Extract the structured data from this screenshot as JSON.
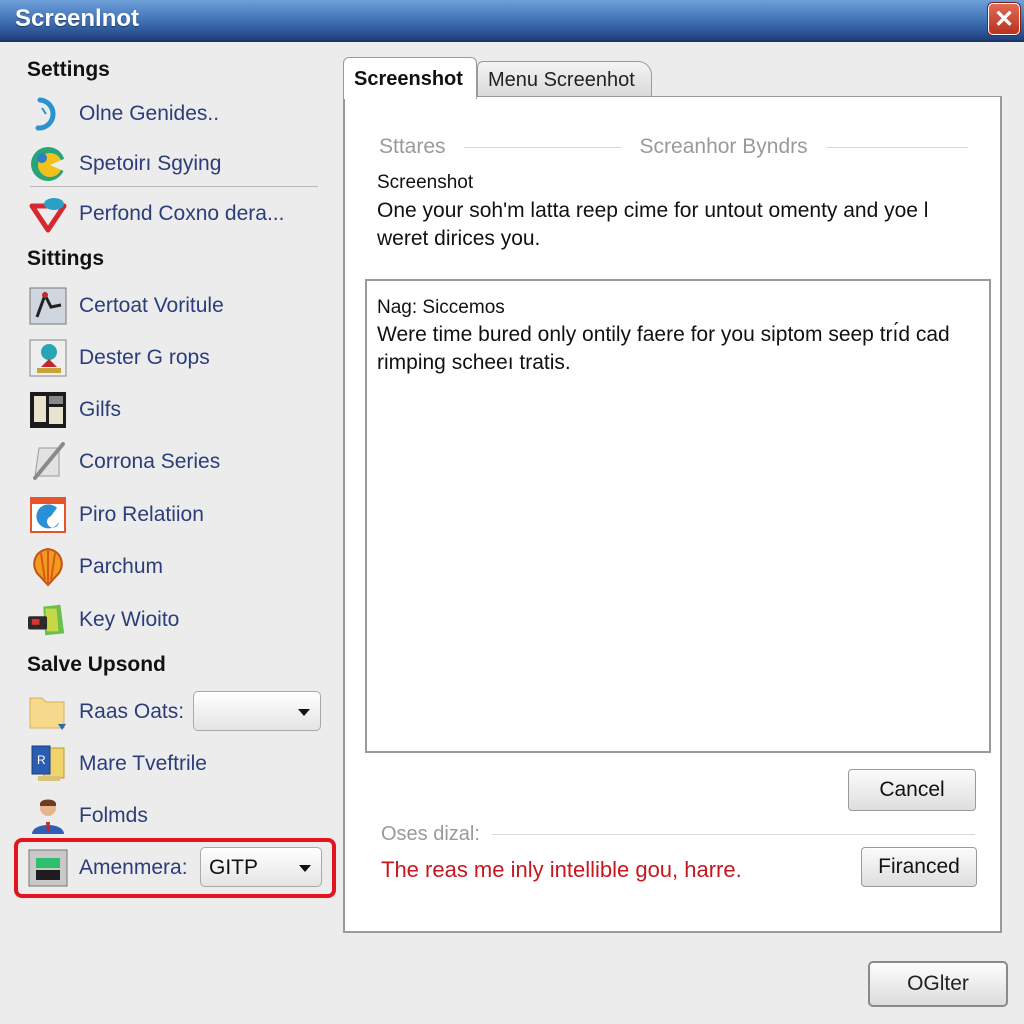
{
  "window": {
    "title": "Screenlnot",
    "close_icon": "close-x-icon"
  },
  "sidebar": {
    "sections": [
      {
        "heading": "Settings",
        "items": [
          {
            "label": "Olne Genides..",
            "icon": "clock-arc-icon"
          },
          {
            "label": "Spetoirı Sgying",
            "icon": "colorful-c-icon"
          },
          {
            "label": "Perfond Coxno dera...",
            "icon": "v-shape-icon"
          }
        ]
      },
      {
        "heading": "Sittings",
        "items": [
          {
            "label": "Certoat Voritule",
            "icon": "figure-icon"
          },
          {
            "label": "Dester G rops",
            "icon": "group-icon"
          },
          {
            "label": "Gilfs",
            "icon": "gallery-icon"
          },
          {
            "label": "Corrona Series",
            "icon": "pen-paper-icon"
          },
          {
            "label": "Piro Relatiion",
            "icon": "blue-swirl-icon"
          },
          {
            "label": "Parchum",
            "icon": "balloon-icon"
          },
          {
            "label": "Key Wioito",
            "icon": "green-key-icon"
          }
        ]
      },
      {
        "heading": "Salve Upsond",
        "items": [
          {
            "label": "Raas Oats:",
            "icon": "folder-icon",
            "dropdown_value": ""
          },
          {
            "label": "Mare Tveftrile",
            "icon": "document-icon"
          },
          {
            "label": "Folmds",
            "icon": "person-icon"
          },
          {
            "label": "Amenmera:",
            "icon": "device-icon",
            "dropdown_value": "GITP",
            "highlighted": true
          }
        ]
      }
    ]
  },
  "tabs": [
    {
      "label": "Screenshot",
      "active": true
    },
    {
      "label": "Menu Screenhot",
      "active": false
    }
  ],
  "panel": {
    "group1_label": "Sttares",
    "group2_label": "Screanhor Byndrs",
    "subtitle": "Screenshot",
    "description": "One your soh'm latta reep cime for untout omenty and yoe l weret dirices you.",
    "box": {
      "title": "Nag: Siccemos",
      "body": "Were time bured only ontily faere for you siptom seep trı́d cad rimping scheeı tratis."
    },
    "cancel_label": "Cancel",
    "group3_label": "Oses dizal:",
    "error_message": "The reas me inly intellible gou, harre.",
    "financed_label": "Firanced"
  },
  "footer": {
    "ok_label": "OGlter"
  },
  "colors": {
    "titlebar": "#2f5a9c",
    "link_text": "#2b3d7a",
    "error_text": "#c8161f",
    "highlight": "#e3141b"
  }
}
